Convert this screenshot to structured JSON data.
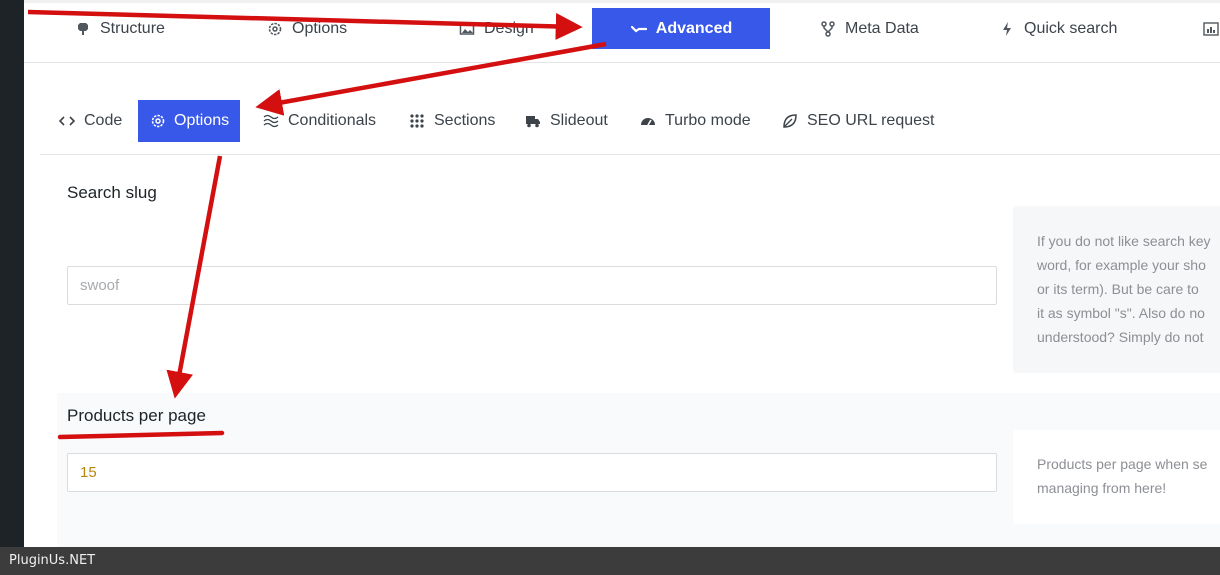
{
  "main_tabs": [
    {
      "label": "Structure",
      "icon": "cubes-icon"
    },
    {
      "label": "Options",
      "icon": "gear-icon"
    },
    {
      "label": "Design",
      "icon": "image-icon"
    },
    {
      "label": "Advanced",
      "icon": "chart-line-icon",
      "active": true
    },
    {
      "label": "Meta Data",
      "icon": "nodes-icon"
    },
    {
      "label": "Quick search",
      "icon": "bolt-icon"
    }
  ],
  "sub_tabs": [
    {
      "label": "Code",
      "icon": "code-icon"
    },
    {
      "label": "Options",
      "icon": "gear-icon",
      "active": true
    },
    {
      "label": "Conditionals",
      "icon": "wave-icon"
    },
    {
      "label": "Sections",
      "icon": "grid-icon"
    },
    {
      "label": "Slideout",
      "icon": "truck-icon"
    },
    {
      "label": "Turbo mode",
      "icon": "gauge-icon"
    },
    {
      "label": "SEO URL request",
      "icon": "leaf-icon"
    }
  ],
  "fields": {
    "search_slug": {
      "label": "Search slug",
      "placeholder": "swoof",
      "help": [
        "If you do not like search key",
        "word, for example your sho",
        "or its term). But be care to",
        "it as symbol \"s\". Also do no",
        "understood? Simply do not"
      ]
    },
    "products_per_page": {
      "label": "Products per page",
      "value": "15",
      "help": [
        "Products per page when se",
        "managing from here!"
      ]
    }
  },
  "footer": {
    "text": "PluginUs.NET"
  },
  "colors": {
    "accent": "#3858e9",
    "annotation": "#d40f0f"
  }
}
